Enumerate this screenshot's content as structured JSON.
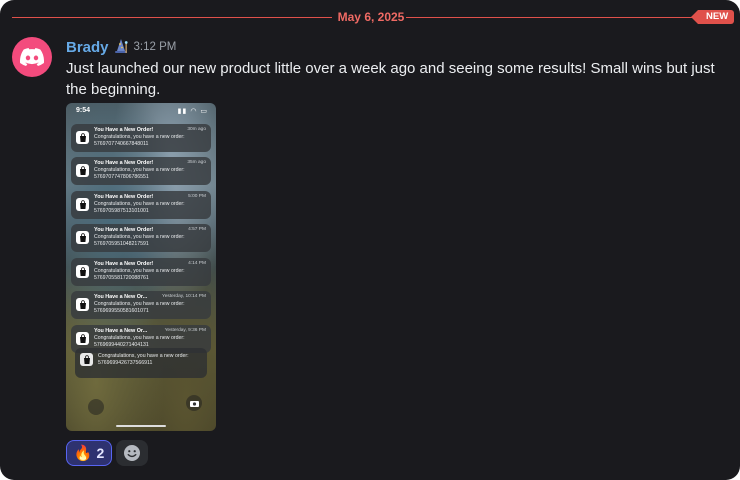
{
  "divider": {
    "date": "May 6, 2025",
    "badge": "NEW"
  },
  "message": {
    "username": "Brady",
    "timestamp": "3:12 PM",
    "text": "Just launched our new product little over a week ago and seeing some results! Small wins but just the beginning."
  },
  "phone": {
    "status_time": "9:54",
    "status_icons": "▮▮ ◠ ▭",
    "notifications": [
      {
        "title": "You Have a New Order!",
        "time": "30m ago",
        "line1": "Congratulations, you have a new order:",
        "line2": "5769707740667848011"
      },
      {
        "title": "You Have a New Order!",
        "time": "35m ago",
        "line1": "Congratulations, you have a new order:",
        "line2": "5769707747806786551"
      },
      {
        "title": "You Have a New Order!",
        "time": "5:00 PM",
        "line1": "Congratulations, you have a new order:",
        "line2": "5769705987513101001"
      },
      {
        "title": "You Have a New Order!",
        "time": "4:57 PM",
        "line1": "Congratulations, you have a new order:",
        "line2": "5769705951048217591"
      },
      {
        "title": "You Have a New Order!",
        "time": "4:14 PM",
        "line1": "Congratulations, you have a new order:",
        "line2": "5769705581720088761"
      },
      {
        "title": "You Have a New Or...",
        "time": "Yesterday, 10:14 PM",
        "line1": "Congratulations, you have a new order:",
        "line2": "5769699550581601071"
      },
      {
        "title": "You Have a New Or...",
        "time": "Yesterday, 9:36 PM",
        "line1": "Congratulations, you have a new order:",
        "line2": "5769699440271404131"
      },
      {
        "title": "",
        "time": "",
        "line1": "Congratulations, you have a new order:",
        "line2": "5769699426737566911"
      }
    ],
    "stack_tail": "5769699371796601221"
  },
  "reactions": [
    {
      "emoji": "🔥",
      "count": "2"
    }
  ],
  "colors": {
    "accent": "#e0514b",
    "username": "#66a9e6",
    "avatar": "#f34b7d",
    "reaction_active": "#5865f2"
  }
}
